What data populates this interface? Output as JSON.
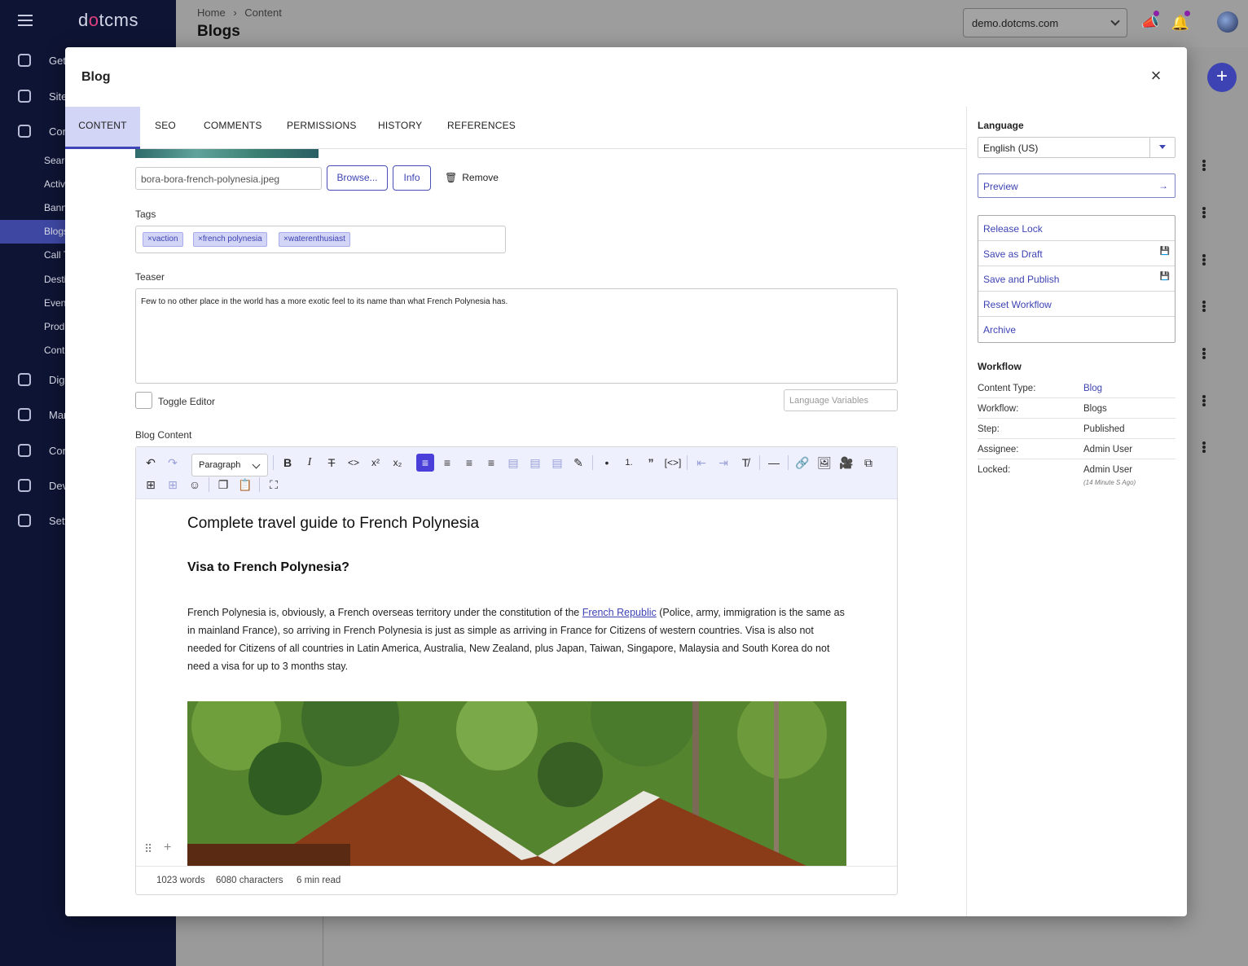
{
  "app": {
    "logo": "dotcms",
    "breadcrumb": {
      "home": "Home",
      "separator": "›",
      "current": "Content"
    },
    "page_title": "Blogs",
    "site": "demo.dotcms.com",
    "fab_label": "+",
    "sidebar": {
      "items": [
        {
          "label": "Get",
          "icon": "dashboard-icon"
        },
        {
          "label": "Site",
          "icon": "folder-icon"
        },
        {
          "label": "Con",
          "icon": "content-icon"
        },
        {
          "label": "Digi",
          "icon": "assets-icon"
        },
        {
          "label": "Mar",
          "icon": "marketing-icon"
        },
        {
          "label": "Con",
          "icon": "copy-icon"
        },
        {
          "label": "Dev",
          "icon": "code-icon"
        },
        {
          "label": "Sett",
          "icon": "gear-icon"
        }
      ],
      "subitems": [
        "Searc",
        "Activ",
        "Bann",
        "Blogs",
        "Call T",
        "Desti",
        "Event",
        "Produ",
        "Conte"
      ],
      "active_subitem": "Blogs"
    }
  },
  "dialog": {
    "title": "Blog",
    "close": "×",
    "tabs": [
      "CONTENT",
      "SEO",
      "COMMENTS",
      "PERMISSIONS",
      "HISTORY",
      "REFERENCES"
    ],
    "active_tab": "CONTENT",
    "image": {
      "filename": "bora-bora-french-polynesia.jpeg",
      "browse_label": "Browse...",
      "info_label": "Info",
      "remove_label": "Remove"
    },
    "tags": {
      "label": "Tags",
      "items": [
        "vaction",
        "french polynesia",
        "waterenthusiast"
      ],
      "remove_glyph": "×"
    },
    "teaser": {
      "label": "Teaser",
      "value": "Few to no other place in the world has a more exotic feel to its name than what French Polynesia has."
    },
    "toggle_editor_label": "Toggle Editor",
    "language_variables_placeholder": "Language Variables",
    "blog_content": {
      "label": "Blog Content",
      "format_select": "Paragraph",
      "heading1": "Complete travel guide to French Polynesia",
      "heading2": "Visa to French Polynesia?",
      "para_before_link": "French Polynesia is, obviously, a French overseas territory under the constitution of the ",
      "link_text": "French Republic",
      "para_after_link": " (Police, army, immigration is the same as in mainland France), so arriving in French Polynesia is just as simple as arriving in France for Citizens of western countries. Visa is also not needed for Citizens of all countries in Latin America, Australia, New Zealand, plus Japan, Taiwan, Singapore, Malaysia and South Korea do not need a visa for up to 3 months stay.",
      "stats": {
        "words": "1023 words",
        "characters": "6080 characters",
        "read": "6 min read"
      }
    },
    "sidebar": {
      "language_label": "Language",
      "language_value": "English (US)",
      "preview_label": "Preview",
      "actions": [
        "Release Lock",
        "Save as Draft",
        "Save and Publish",
        "Reset Workflow",
        "Archive"
      ],
      "workflow_label": "Workflow",
      "workflow_rows": [
        {
          "key": "Content Type:",
          "value": "Blog"
        },
        {
          "key": "Workflow:",
          "value": "Blogs"
        },
        {
          "key": "Step:",
          "value": "Published"
        },
        {
          "key": "Assignee:",
          "value": "Admin User"
        },
        {
          "key": "Locked:",
          "value": "Admin User"
        }
      ],
      "locked_ago": "(14 Minute S Ago)"
    }
  },
  "colors": {
    "accent": "#3d43b3",
    "sidebar_bg": "#0e1433",
    "tab_active_bg": "#d2d5f5"
  }
}
